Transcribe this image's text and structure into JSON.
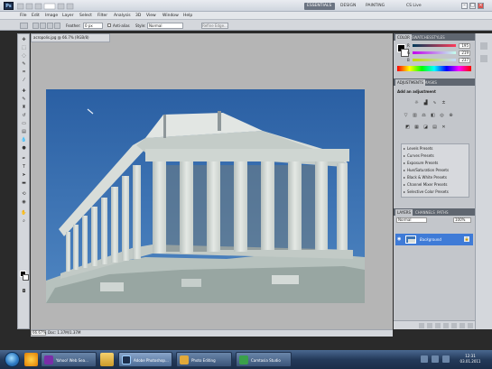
{
  "app": {
    "logo": "Ps",
    "colors": {
      "accent": "#3f7bd7",
      "chrome": "#d4d7dc",
      "workspace": "#b5b5b5"
    }
  },
  "titlebar": {
    "workspaces": [
      "ESSENTIALS",
      "DESIGN",
      "PAINTING"
    ],
    "cs_live": "CS Live",
    "window_buttons": [
      "–",
      "□",
      "×"
    ]
  },
  "menubar": {
    "items": [
      "File",
      "Edit",
      "Image",
      "Layer",
      "Select",
      "Filter",
      "Analysis",
      "3D",
      "View",
      "Window",
      "Help"
    ]
  },
  "options": {
    "feather_label": "Feather:",
    "feather_value": "0 px",
    "anti_alias_label": "Anti-alias",
    "style_label": "Style:",
    "style_value": "Normal",
    "refine_edge_label": "Refine Edge..."
  },
  "document": {
    "tab_label": "acropolis.jpg @ 66.7% (RGB/8)",
    "zoom": "66.67%",
    "doc_size": "Doc: 1.37M/1.37M"
  },
  "panels": {
    "color_tabs": [
      "COLOR",
      "SWATCHES",
      "STYLES"
    ],
    "channels": [
      {
        "label": "R",
        "value": "195"
      },
      {
        "label": "G",
        "value": "219"
      },
      {
        "label": "B",
        "value": "237"
      }
    ],
    "adj_tabs": [
      "ADJUSTMENTS",
      "MASKS"
    ],
    "add_adjustment": "Add an adjustment",
    "presets": [
      "Levels Presets",
      "Curves Presets",
      "Exposure Presets",
      "Hue/Saturation Presets",
      "Black & White Presets",
      "Channel Mixer Presets",
      "Selective Color Presets"
    ],
    "layer_tabs": [
      "LAYERS",
      "CHANNELS",
      "PATHS"
    ],
    "blend_mode": "Normal",
    "opacity": "100%",
    "layer_name": "Background"
  },
  "taskbar": {
    "tasks": [
      "Yahoo! Web Sea...",
      "Adobe Photoshop...",
      "Photo Editing",
      "Camtasia Studio"
    ],
    "clock_time": "12:31",
    "clock_date": "03.01.2011"
  }
}
